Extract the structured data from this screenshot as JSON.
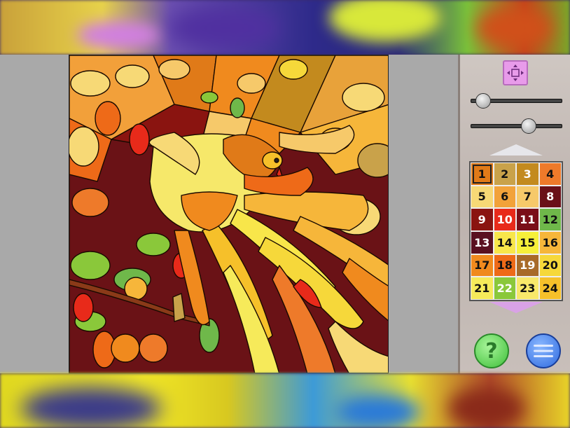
{
  "palette": {
    "selected": "1",
    "swatches": [
      {
        "num": "1",
        "color": "#e07a18"
      },
      {
        "num": "2",
        "color": "#c9a24a"
      },
      {
        "num": "3",
        "color": "#c38a1e"
      },
      {
        "num": "4",
        "color": "#ee7a2a"
      },
      {
        "num": "5",
        "color": "#f7d976"
      },
      {
        "num": "6",
        "color": "#f2a23a"
      },
      {
        "num": "7",
        "color": "#f6c96a"
      },
      {
        "num": "8",
        "color": "#6a1018"
      },
      {
        "num": "9",
        "color": "#8a1410"
      },
      {
        "num": "10",
        "color": "#e82a1a"
      },
      {
        "num": "11",
        "color": "#7a0e18"
      },
      {
        "num": "12",
        "color": "#6fb84a"
      },
      {
        "num": "13",
        "color": "#5a1020"
      },
      {
        "num": "14",
        "color": "#f8e64a"
      },
      {
        "num": "15",
        "color": "#f6f03a"
      },
      {
        "num": "16",
        "color": "#f6b63a"
      },
      {
        "num": "17",
        "color": "#f08a1e"
      },
      {
        "num": "18",
        "color": "#ee6a18"
      },
      {
        "num": "19",
        "color": "#a86a28"
      },
      {
        "num": "20",
        "color": "#f6d83a"
      },
      {
        "num": "21",
        "color": "#f6ea5a"
      },
      {
        "num": "22",
        "color": "#8ac83a"
      },
      {
        "num": "23",
        "color": "#f8e86a"
      },
      {
        "num": "24",
        "color": "#f6c02a"
      }
    ]
  },
  "sliders": {
    "zoom_level": 0.06,
    "brush_level": 0.66
  },
  "icons": {
    "fit": "fit-to-screen-icon",
    "help": "question-mark-icon",
    "menu": "hamburger-menu-icon"
  },
  "help_label": "?",
  "colors": {
    "panel_bg": "#c6bdb8",
    "work_area": "#a9a9a9",
    "fit_button": "#e89bea",
    "help_button": "#3fbf3a",
    "menu_button": "#2f6adf"
  }
}
